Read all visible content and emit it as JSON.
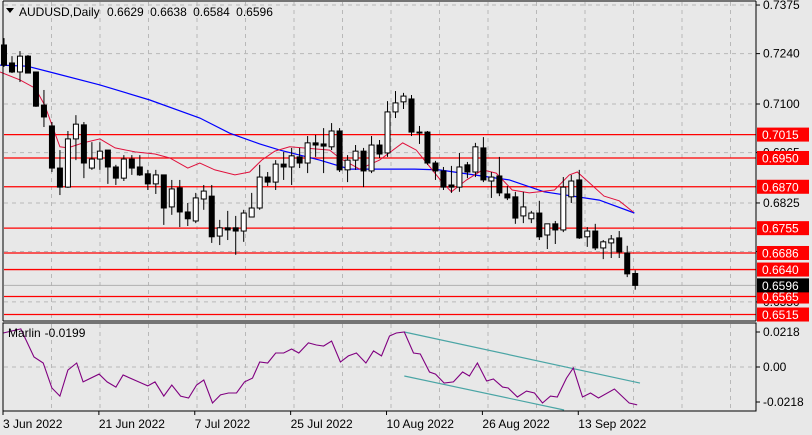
{
  "header": {
    "symbol_timeframe": "AUDUSD,Daily",
    "open": "0.6629",
    "high": "0.6638",
    "low": "0.6584",
    "close": "0.6596"
  },
  "colors": {
    "background": "#e8e8e8",
    "grid": "#b8b8b8",
    "level": "#ff0000",
    "ma_fast": "#e0103c",
    "ma_slow": "#0000ff",
    "indicator": "#800080",
    "trendline": "#4aa5a5",
    "current_price_line": "#b0b0b0"
  },
  "chart_data": {
    "type": "candlestick",
    "symbol": "AUDUSD",
    "timeframe": "Daily",
    "ylim": [
      0.6497,
      0.7389
    ],
    "price_ticks": [
      {
        "price": 0.7375,
        "label": "0.7375"
      },
      {
        "price": 0.724,
        "label": "0.7240"
      },
      {
        "price": 0.71,
        "label": "0.7100"
      },
      {
        "price": 0.6965,
        "label": "0.6965"
      },
      {
        "price": 0.6825,
        "label": "0.6825"
      },
      {
        "price": 0.669,
        "label": "0.6690"
      },
      {
        "price": 0.655,
        "label": "0.6550"
      }
    ],
    "date_labels": [
      {
        "bar": 1,
        "label": "3 Jun 2022"
      },
      {
        "bar": 13,
        "label": "21 Jun 2022"
      },
      {
        "bar": 25,
        "label": "7 Jul 2022"
      },
      {
        "bar": 37,
        "label": "25 Jul 2022"
      },
      {
        "bar": 49,
        "label": "10 Aug 2022"
      },
      {
        "bar": 61,
        "label": "26 Aug 2022"
      },
      {
        "bar": 73,
        "label": "13 Sep 2022"
      }
    ],
    "candles": [
      [
        0.7264,
        0.7283,
        0.7203,
        0.7208
      ],
      [
        0.7214,
        0.7233,
        0.7186,
        0.7189
      ],
      [
        0.7189,
        0.7247,
        0.7161,
        0.7233
      ],
      [
        0.7233,
        0.7236,
        0.7186,
        0.7186
      ],
      [
        0.7189,
        0.7189,
        0.7092,
        0.7094
      ],
      [
        0.7097,
        0.7139,
        0.7036,
        0.7064
      ],
      [
        0.7039,
        0.705,
        0.6911,
        0.6922
      ],
      [
        0.6922,
        0.6972,
        0.6847,
        0.6869
      ],
      [
        0.6869,
        0.7025,
        0.6867,
        0.7003
      ],
      [
        0.7003,
        0.7069,
        0.6944,
        0.7044
      ],
      [
        0.7042,
        0.705,
        0.6894,
        0.6936
      ],
      [
        0.6922,
        0.6994,
        0.6917,
        0.6947
      ],
      [
        0.6947,
        0.6994,
        0.6917,
        0.6969
      ],
      [
        0.6972,
        0.6972,
        0.6878,
        0.6925
      ],
      [
        0.6925,
        0.6931,
        0.6875,
        0.6894
      ],
      [
        0.6894,
        0.6958,
        0.6886,
        0.6947
      ],
      [
        0.6947,
        0.6958,
        0.6903,
        0.6922
      ],
      [
        0.6925,
        0.6958,
        0.69,
        0.6903
      ],
      [
        0.6906,
        0.6917,
        0.6861,
        0.6878
      ],
      [
        0.6878,
        0.6917,
        0.685,
        0.6903
      ],
      [
        0.6903,
        0.6903,
        0.6764,
        0.6811
      ],
      [
        0.6814,
        0.6889,
        0.6792,
        0.6864
      ],
      [
        0.6867,
        0.6889,
        0.6758,
        0.68
      ],
      [
        0.68,
        0.6825,
        0.6761,
        0.6781
      ],
      [
        0.6775,
        0.6853,
        0.6769,
        0.6839
      ],
      [
        0.6836,
        0.6875,
        0.6806,
        0.6858
      ],
      [
        0.6844,
        0.6875,
        0.6714,
        0.6731
      ],
      [
        0.6733,
        0.6778,
        0.6708,
        0.6756
      ],
      [
        0.6756,
        0.6803,
        0.6722,
        0.675
      ],
      [
        0.6756,
        0.6789,
        0.6681,
        0.6747
      ],
      [
        0.6747,
        0.6806,
        0.6717,
        0.6797
      ],
      [
        0.6786,
        0.6853,
        0.6786,
        0.6811
      ],
      [
        0.6811,
        0.6931,
        0.6806,
        0.6897
      ],
      [
        0.6897,
        0.6911,
        0.6872,
        0.6883
      ],
      [
        0.6883,
        0.6944,
        0.6861,
        0.6933
      ],
      [
        0.6933,
        0.6967,
        0.6889,
        0.6925
      ],
      [
        0.6925,
        0.6978,
        0.6875,
        0.6956
      ],
      [
        0.6953,
        0.6978,
        0.6922,
        0.6936
      ],
      [
        0.6936,
        0.7011,
        0.6908,
        0.6992
      ],
      [
        0.6992,
        0.7014,
        0.6953,
        0.6986
      ],
      [
        0.6989,
        0.7033,
        0.6908,
        0.6983
      ],
      [
        0.6981,
        0.7047,
        0.6972,
        0.7025
      ],
      [
        0.7025,
        0.7033,
        0.6911,
        0.6917
      ],
      [
        0.6917,
        0.6958,
        0.6883,
        0.6944
      ],
      [
        0.6944,
        0.6986,
        0.6917,
        0.6969
      ],
      [
        0.6969,
        0.6978,
        0.6869,
        0.6914
      ],
      [
        0.6914,
        0.7011,
        0.6908,
        0.6986
      ],
      [
        0.6986,
        0.7,
        0.695,
        0.6961
      ],
      [
        0.6964,
        0.7108,
        0.6953,
        0.7078
      ],
      [
        0.7078,
        0.7136,
        0.7061,
        0.7103
      ],
      [
        0.7106,
        0.7131,
        0.7086,
        0.7122
      ],
      [
        0.7114,
        0.7125,
        0.7011,
        0.7022
      ],
      [
        0.7022,
        0.7039,
        0.6989,
        0.7022
      ],
      [
        0.7022,
        0.7025,
        0.6931,
        0.6936
      ],
      [
        0.6936,
        0.6942,
        0.6889,
        0.6914
      ],
      [
        0.6914,
        0.6925,
        0.6861,
        0.6869
      ],
      [
        0.6875,
        0.6928,
        0.6853,
        0.6869
      ],
      [
        0.6869,
        0.6964,
        0.6856,
        0.6925
      ],
      [
        0.6931,
        0.6939,
        0.6894,
        0.6911
      ],
      [
        0.6911,
        0.6992,
        0.6897,
        0.6981
      ],
      [
        0.6978,
        0.7008,
        0.6883,
        0.6889
      ],
      [
        0.6886,
        0.6911,
        0.6839,
        0.6897
      ],
      [
        0.69,
        0.6953,
        0.6844,
        0.6853
      ],
      [
        0.685,
        0.6872,
        0.6833,
        0.6839
      ],
      [
        0.6842,
        0.6856,
        0.6767,
        0.6783
      ],
      [
        0.6789,
        0.6856,
        0.6769,
        0.6814
      ],
      [
        0.6781,
        0.6803,
        0.6769,
        0.6797
      ],
      [
        0.6797,
        0.6831,
        0.6722,
        0.6731
      ],
      [
        0.6736,
        0.6767,
        0.6697,
        0.6767
      ],
      [
        0.6767,
        0.6775,
        0.6711,
        0.675
      ],
      [
        0.675,
        0.6897,
        0.6744,
        0.6869
      ],
      [
        0.6842,
        0.6903,
        0.6825,
        0.6886
      ],
      [
        0.6889,
        0.6917,
        0.6725,
        0.6728
      ],
      [
        0.6731,
        0.6758,
        0.6703,
        0.6747
      ],
      [
        0.6747,
        0.6767,
        0.6694,
        0.67
      ],
      [
        0.67,
        0.6722,
        0.6669,
        0.6717
      ],
      [
        0.6714,
        0.6736,
        0.6672,
        0.6725
      ],
      [
        0.6728,
        0.6747,
        0.6672,
        0.6689
      ],
      [
        0.6686,
        0.6706,
        0.6619,
        0.6628
      ],
      [
        0.6629,
        0.6638,
        0.6584,
        0.6596
      ]
    ],
    "ma_fast": [
      [
        0.5,
        0.7189
      ],
      [
        3,
        0.7167
      ],
      [
        4.9,
        0.7144
      ],
      [
        6.1,
        0.7097
      ],
      [
        8,
        0.6981
      ],
      [
        9,
        0.6978
      ],
      [
        10.9,
        0.6992
      ],
      [
        13,
        0.7003
      ],
      [
        14.9,
        0.6978
      ],
      [
        17.4,
        0.6967
      ],
      [
        19.9,
        0.6961
      ],
      [
        21.75,
        0.695
      ],
      [
        24,
        0.6922
      ],
      [
        25.5,
        0.6936
      ],
      [
        27.4,
        0.6917
      ],
      [
        29.9,
        0.6903
      ],
      [
        31.75,
        0.6911
      ],
      [
        33.25,
        0.6944
      ],
      [
        34.9,
        0.6969
      ],
      [
        36.75,
        0.6981
      ],
      [
        38.4,
        0.6978
      ],
      [
        41.75,
        0.6972
      ],
      [
        43,
        0.695
      ],
      [
        45.5,
        0.6919
      ],
      [
        48,
        0.6944
      ],
      [
        50.9,
        0.6992
      ],
      [
        52.6,
        0.6972
      ],
      [
        53.9,
        0.6936
      ],
      [
        55.9,
        0.6881
      ],
      [
        57,
        0.6856
      ],
      [
        58.9,
        0.6889
      ],
      [
        60.9,
        0.6917
      ],
      [
        62.6,
        0.6908
      ],
      [
        64.6,
        0.6861
      ],
      [
        66.75,
        0.6853
      ],
      [
        69.9,
        0.6861
      ],
      [
        71.75,
        0.6903
      ],
      [
        72.75,
        0.6911
      ],
      [
        74.25,
        0.6881
      ],
      [
        76.1,
        0.6844
      ],
      [
        78,
        0.6831
      ],
      [
        79.75,
        0.68
      ]
    ],
    "ma_slow": [
      [
        0.5,
        0.7208
      ],
      [
        3.9,
        0.7205
      ],
      [
        6.75,
        0.7189
      ],
      [
        13,
        0.7153
      ],
      [
        19.25,
        0.7111
      ],
      [
        25.5,
        0.7061
      ],
      [
        29.25,
        0.7019
      ],
      [
        33,
        0.6989
      ],
      [
        35.5,
        0.6972
      ],
      [
        40.5,
        0.6944
      ],
      [
        44.25,
        0.6919
      ],
      [
        52.4,
        0.6919
      ],
      [
        55.5,
        0.6917
      ],
      [
        61.75,
        0.6897
      ],
      [
        64.25,
        0.6889
      ],
      [
        68.6,
        0.6856
      ],
      [
        75.5,
        0.6833
      ],
      [
        79.9,
        0.6797
      ]
    ],
    "levels": [
      {
        "price": 0.7015,
        "label": "0.7015"
      },
      {
        "price": 0.695,
        "label": "0.6950"
      },
      {
        "price": 0.687,
        "label": "0.6870"
      },
      {
        "price": 0.6755,
        "label": "0.6755"
      },
      {
        "price": 0.6686,
        "label": "0.6686"
      },
      {
        "price": 0.664,
        "label": "0.6640"
      },
      {
        "price": 0.6565,
        "label": "0.6565"
      },
      {
        "price": 0.6515,
        "label": "0.6515"
      }
    ],
    "current_price": {
      "price": 0.6596,
      "label": "0.6596"
    },
    "indicator": {
      "name": "Marlin",
      "value_label": "-0.0199",
      "ylim": [
        -0.0274,
        0.0274
      ],
      "ticks": [
        {
          "value": 0.0218,
          "label": "0.0218"
        },
        {
          "value": 0,
          "label": "0.00"
        },
        {
          "value": -0.0218,
          "label": "-0.0218"
        }
      ],
      "points": [
        [
          0.9,
          0.0212
        ],
        [
          3.1,
          0.0237
        ],
        [
          4.75,
          0.0062
        ],
        [
          5.9,
          0.0025
        ],
        [
          7,
          -0.0131
        ],
        [
          8,
          -0.0181
        ],
        [
          9,
          -0.0019
        ],
        [
          10.1,
          0.0025
        ],
        [
          10.9,
          -0.0093
        ],
        [
          12.9,
          -0.0044
        ],
        [
          13.9,
          -0.0093
        ],
        [
          15,
          -0.0125
        ],
        [
          15.9,
          -0.005
        ],
        [
          19,
          -0.0118
        ],
        [
          19.9,
          -0.0093
        ],
        [
          21,
          -0.0181
        ],
        [
          22,
          -0.0112
        ],
        [
          23.1,
          -0.0181
        ],
        [
          24.1,
          -0.0193
        ],
        [
          25.1,
          -0.0112
        ],
        [
          26,
          -0.0081
        ],
        [
          27.1,
          -0.0224
        ],
        [
          28.1,
          -0.0174
        ],
        [
          29.1,
          -0.0162
        ],
        [
          30.1,
          -0.0162
        ],
        [
          31.1,
          -0.0093
        ],
        [
          32.1,
          -0.0069
        ],
        [
          33,
          0.0031
        ],
        [
          34,
          0.0025
        ],
        [
          35,
          0.0087
        ],
        [
          36,
          0.0087
        ],
        [
          37,
          0.0112
        ],
        [
          37.9,
          0.0087
        ],
        [
          39.1,
          0.015
        ],
        [
          40.1,
          0.0137
        ],
        [
          41,
          0.0131
        ],
        [
          42,
          0.0162
        ],
        [
          43.1,
          0.0031
        ],
        [
          44.1,
          0.0069
        ],
        [
          45.1,
          0.0087
        ],
        [
          46.3,
          0.0025
        ],
        [
          47.25,
          0.01
        ],
        [
          48.25,
          0.0069
        ],
        [
          49.25,
          0.0193
        ],
        [
          50.1,
          0.0212
        ],
        [
          51.1,
          0.0218
        ],
        [
          52.25,
          0.0087
        ],
        [
          53.1,
          0.0081
        ],
        [
          54.25,
          -0.0031
        ],
        [
          55,
          -0.0044
        ],
        [
          56.1,
          -0.01
        ],
        [
          57.25,
          -0.0093
        ],
        [
          58.4,
          -0.0031
        ],
        [
          59.25,
          -0.0056
        ],
        [
          60.25,
          0.0025
        ],
        [
          61.4,
          -0.0087
        ],
        [
          62.25,
          -0.0075
        ],
        [
          63.4,
          -0.0125
        ],
        [
          64.1,
          -0.0131
        ],
        [
          65.25,
          -0.0187
        ],
        [
          66.4,
          -0.015
        ],
        [
          67.4,
          -0.0162
        ],
        [
          68.4,
          -0.0224
        ],
        [
          69.4,
          -0.0181
        ],
        [
          70.25,
          -0.0187
        ],
        [
          71.4,
          -0.0069
        ],
        [
          72.25,
          -0.0006
        ],
        [
          73.4,
          -0.0187
        ],
        [
          74.4,
          -0.0162
        ],
        [
          75.4,
          -0.0193
        ],
        [
          77.4,
          -0.0137
        ],
        [
          79.25,
          -0.0224
        ],
        [
          80.25,
          -0.0236
        ]
      ],
      "trendlines": [
        [
          [
            51.1,
            0.0218
          ],
          [
            80.6,
            -0.01
          ]
        ],
        [
          [
            51.1,
            -0.0056
          ],
          [
            71.1,
            -0.0268
          ]
        ]
      ]
    }
  }
}
